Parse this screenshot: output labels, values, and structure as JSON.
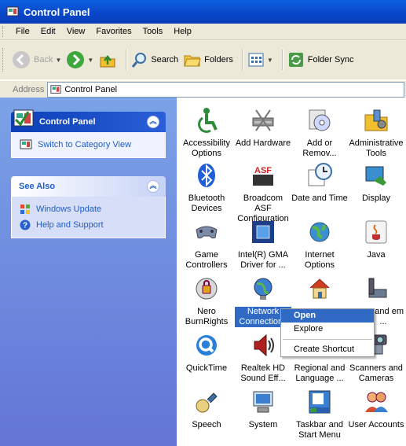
{
  "window": {
    "title": "Control Panel"
  },
  "menu": [
    "File",
    "Edit",
    "View",
    "Favorites",
    "Tools",
    "Help"
  ],
  "toolbar": {
    "back": "Back",
    "search": "Search",
    "folders": "Folders",
    "folder_sync": "Folder Sync"
  },
  "address": {
    "label": "Address",
    "value": "Control Panel"
  },
  "sidebar": {
    "control_panel": {
      "title": "Control Panel",
      "link": "Switch to Category View"
    },
    "see_also": {
      "title": "See Also",
      "links": [
        "Windows Update",
        "Help and Support"
      ]
    }
  },
  "items": [
    {
      "label": "Accessibility Options",
      "icon": "accessibility-icon"
    },
    {
      "label": "Add Hardware",
      "icon": "add-hardware-icon"
    },
    {
      "label": "Add or Remov...",
      "icon": "add-remove-programs-icon"
    },
    {
      "label": "Administrative Tools",
      "icon": "administrative-tools-icon"
    },
    {
      "label": "Bluetooth Devices",
      "icon": "bluetooth-icon"
    },
    {
      "label": "Broadcom ASF Configuration",
      "icon": "broadcom-asf-icon"
    },
    {
      "label": "Date and Time",
      "icon": "date-time-icon"
    },
    {
      "label": "Display",
      "icon": "display-icon"
    },
    {
      "label": "Game Controllers",
      "icon": "game-controller-icon"
    },
    {
      "label": "Intel(R) GMA Driver for ...",
      "icon": "intel-gma-icon"
    },
    {
      "label": "Internet Options",
      "icon": "internet-options-icon"
    },
    {
      "label": "Java",
      "icon": "java-icon"
    },
    {
      "label": "Nero BurnRights",
      "icon": "nero-icon"
    },
    {
      "label": "Network Connections",
      "icon": "network-icon"
    },
    {
      "label": "",
      "icon": "home-network-icon"
    },
    {
      "label": "ne and em ...",
      "icon": "phone-modem-icon"
    },
    {
      "label": "QuickTime",
      "icon": "quicktime-icon"
    },
    {
      "label": "Realtek HD Sound Eff...",
      "icon": "realtek-sound-icon"
    },
    {
      "label": "Regional and Language ...",
      "icon": "regional-language-icon"
    },
    {
      "label": "Scanners and Cameras",
      "icon": "scanner-camera-icon"
    },
    {
      "label": "Speech",
      "icon": "speech-icon"
    },
    {
      "label": "System",
      "icon": "system-icon"
    },
    {
      "label": "Taskbar and Start Menu",
      "icon": "taskbar-icon"
    },
    {
      "label": "User Accounts",
      "icon": "user-accounts-icon"
    }
  ],
  "context_menu": [
    "Open",
    "Explore",
    "Create Shortcut"
  ],
  "colors": {
    "title_blue": "#0a5fe0",
    "sidebar_blue": "#7ba2e7",
    "selection": "#316ac5"
  }
}
